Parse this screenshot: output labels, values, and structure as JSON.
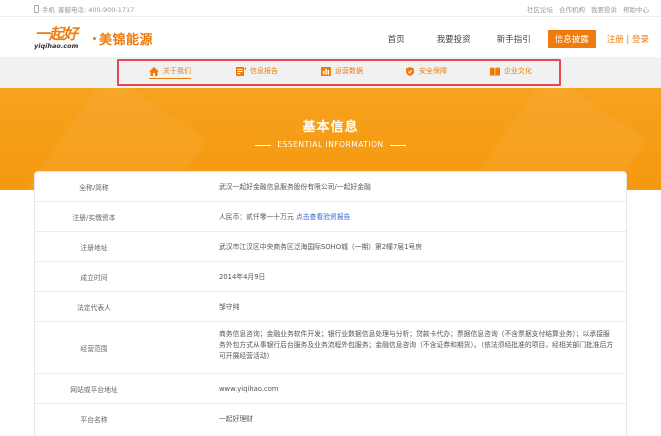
{
  "topbar": {
    "service_label": "手机",
    "hotline": "客服电话: 400-900-1717",
    "links": [
      "社区论坛",
      "合作机构",
      "我要投诉",
      "帮助中心"
    ]
  },
  "logo": {
    "mark_cn": "一起好",
    "mark_en": "yiqihao.com",
    "brand": "美锦能源"
  },
  "nav": {
    "items": [
      "首页",
      "我要投资",
      "新手指引"
    ],
    "cta_label": "信息披露",
    "auth_label": "注册 | 登录"
  },
  "subnav": {
    "items": [
      {
        "label": "关于我们",
        "icon": "home-icon"
      },
      {
        "label": "信息报告",
        "icon": "document-icon"
      },
      {
        "label": "运营数据",
        "icon": "bar-chart-icon"
      },
      {
        "label": "安全保障",
        "icon": "shield-icon"
      },
      {
        "label": "企业文化",
        "icon": "book-icon"
      }
    ]
  },
  "banner": {
    "title": "基本信息",
    "subtitle": "ESSENTIAL INFORMATION"
  },
  "info": {
    "rows": [
      {
        "label": "全称/简称",
        "value": "武汉一起好金融信息服务股份有限公司/一起好金融"
      },
      {
        "label": "注册/实缴资本",
        "value": "人民币：贰仟零一十万元",
        "link": "点击查看验资报告"
      },
      {
        "label": "注册地址",
        "value": "武汉市江汉区中央商务区泛海国际SOHO城（一期）第2幢7层1号房"
      },
      {
        "label": "成立时间",
        "value": "2014年4月9日"
      },
      {
        "label": "法定代表人",
        "value": "邹守纯"
      },
      {
        "label": "经营范围",
        "value": "商务信息咨询；金融业务软件开发；银行业数据信息处理与分析；贷款卡代办；票据信息咨询（不含票据支付结算业务）；以承接服务外包方式从事银行后台服务及业务流程外包服务；金融信息咨询（不含证券和期货）。（依法须经批准的项目，经相关部门批准后方可开展经营活动）"
      },
      {
        "label": "网站或平台地址",
        "value": "www.yiqihao.com"
      },
      {
        "label": "平台名称",
        "value": "一起好理财"
      }
    ]
  },
  "colors": {
    "accent": "#ee7b0c",
    "banner": "#f5980f",
    "highlight_box": "#e5484d"
  }
}
